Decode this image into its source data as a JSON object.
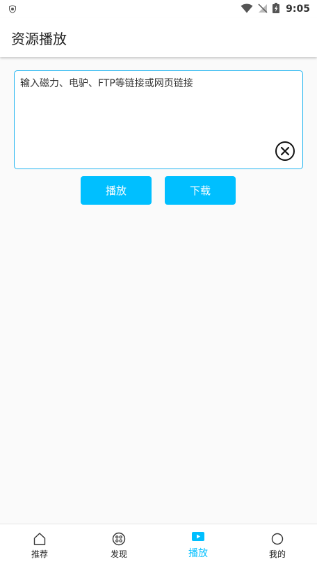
{
  "status_bar": {
    "time": "9:05",
    "icons": [
      "shield-icon",
      "wifi-icon",
      "no-signal-icon",
      "battery-charging-icon"
    ]
  },
  "app_bar": {
    "title": "资源播放"
  },
  "url_input": {
    "placeholder": "输入磁力、电驴、FTP等链接或网页链接",
    "value": ""
  },
  "buttons": {
    "play_label": "播放",
    "download_label": "下载"
  },
  "bottom_nav": {
    "items": [
      {
        "label": "推荐",
        "icon": "home-icon",
        "active": false
      },
      {
        "label": "发现",
        "icon": "discover-icon",
        "active": false
      },
      {
        "label": "播放",
        "icon": "play-icon",
        "active": true
      },
      {
        "label": "我的",
        "icon": "profile-icon",
        "active": false
      }
    ]
  },
  "colors": {
    "accent": "#00bfff",
    "input_border": "#22b5f0",
    "background": "#fafafa"
  }
}
